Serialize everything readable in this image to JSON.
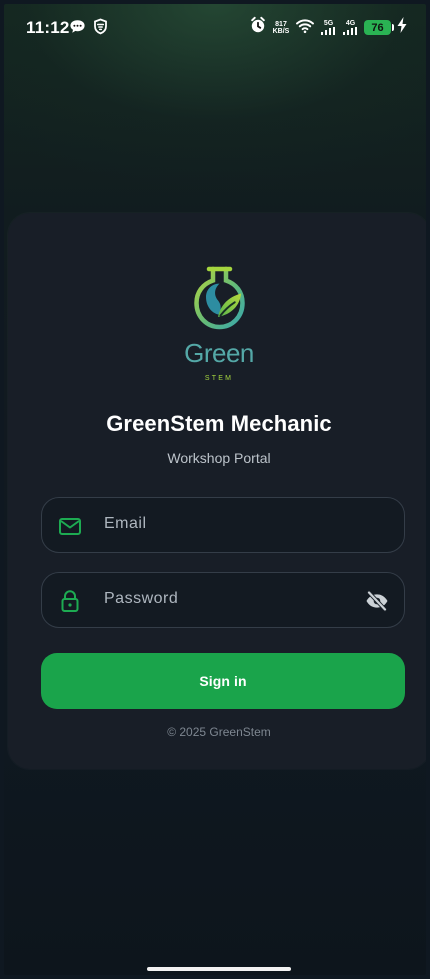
{
  "status_bar": {
    "time": "11:12",
    "network_speed_value": "817",
    "network_speed_unit": "KB/S",
    "network_5g": "5G",
    "network_4g": "4G",
    "battery_percent": "76",
    "icons": [
      "chat-bubble-icon",
      "vpn-shield-icon",
      "alarm-icon",
      "wifi-icon",
      "signal-icon",
      "battery-icon",
      "charging-icon"
    ]
  },
  "brand": {
    "logo_word": "Green",
    "logo_sub": "STEM",
    "primary_color": "#1aa44b",
    "logo_teal": "#54a8a7",
    "logo_lime": "#a5d63f"
  },
  "login": {
    "title": "GreenStem Mechanic",
    "subtitle": "Workshop Portal",
    "email_placeholder": "Email",
    "password_placeholder": "Password",
    "password_visibility": "hidden",
    "sign_in_label": "Sign in",
    "copyright": "© 2025 GreenStem"
  }
}
